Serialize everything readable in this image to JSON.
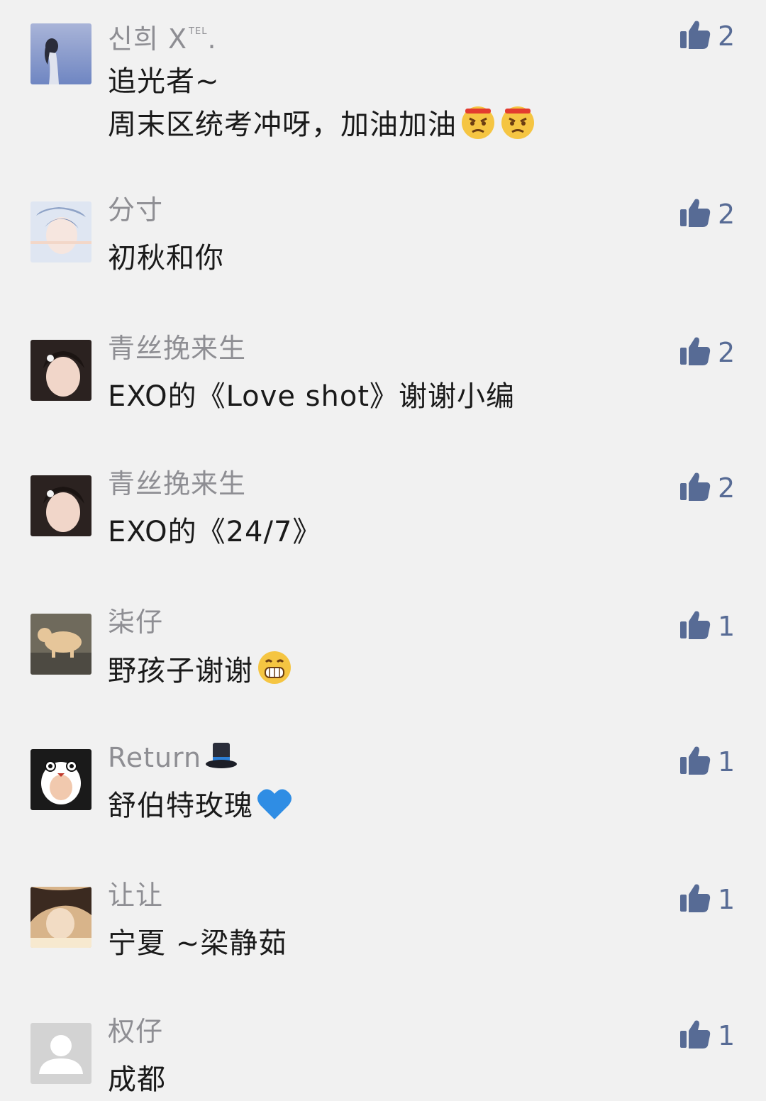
{
  "comments": [
    {
      "name": "신희 X",
      "name_suffix": "TEL",
      "name_tail": ".",
      "lines": [
        "追光者~",
        "周末区统考冲呀，加油加油"
      ],
      "likes": "2"
    },
    {
      "name": "分寸",
      "lines": [
        "初秋和你"
      ],
      "likes": "2"
    },
    {
      "name": "青丝挽来生",
      "lines": [
        "EXO的《Love shot》谢谢小编"
      ],
      "likes": "2"
    },
    {
      "name": "青丝挽来生",
      "lines": [
        "EXO的《24/7》"
      ],
      "likes": "2"
    },
    {
      "name": "柒仔",
      "lines": [
        "野孩子谢谢"
      ],
      "likes": "1"
    },
    {
      "name": "Return",
      "lines": [
        "舒伯特玫瑰"
      ],
      "likes": "1"
    },
    {
      "name": "让让",
      "lines": [
        "宁夏 ~梁静茹"
      ],
      "likes": "1"
    },
    {
      "name": "权仔",
      "lines": [
        "成都"
      ],
      "likes": "1"
    }
  ],
  "colors": {
    "background": "#f1f1f1",
    "name": "#8e8e93",
    "text": "#1a1a1a",
    "like": "#576b95"
  }
}
